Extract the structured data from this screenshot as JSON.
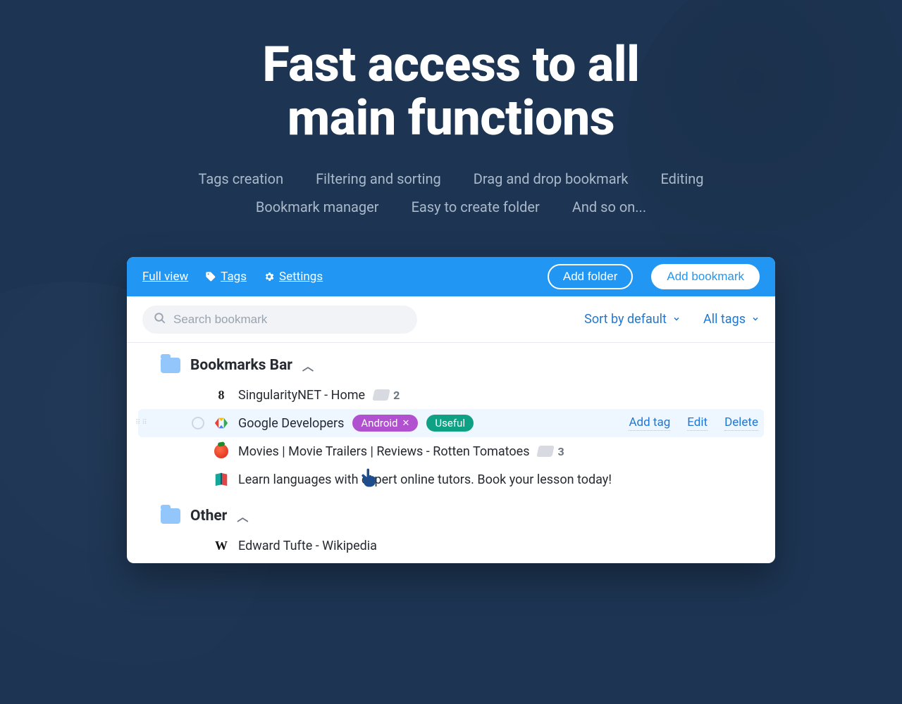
{
  "hero": {
    "title_line1": "Fast access to all",
    "title_line2": "main functions"
  },
  "features": [
    "Tags creation",
    "Filtering and sorting",
    "Drag and drop bookmark",
    "Editing",
    "Bookmark manager",
    "Easy to create folder",
    "And so on..."
  ],
  "toolbar": {
    "full_view": "Full view",
    "tags": "Tags",
    "settings": "Settings",
    "add_folder": "Add folder",
    "add_bookmark": "Add bookmark"
  },
  "controls": {
    "search_placeholder": "Search bookmark",
    "sort": "Sort by default",
    "all_tags": "All tags"
  },
  "folders": [
    {
      "name": "Bookmarks Bar",
      "items": [
        {
          "title": "SingularityNET - Home",
          "tag_count": "2",
          "favicon": "singularitynet"
        },
        {
          "title": "Google Developers",
          "favicon": "gdev",
          "tags": [
            {
              "label": "Android",
              "color": "purple",
              "removable": true
            },
            {
              "label": "Useful",
              "color": "green",
              "removable": false
            }
          ],
          "active": true,
          "actions": {
            "addtag": "Add tag",
            "edit": "Edit",
            "delete": "Delete"
          }
        },
        {
          "title": "Movies | Movie Trailers | Reviews - Rotten Tomatoes",
          "tag_count": "3",
          "favicon": "tomato"
        },
        {
          "title": "Learn languages with expert online tutors. Book your lesson today!",
          "favicon": "preply"
        }
      ]
    },
    {
      "name": "Other",
      "items": [
        {
          "title": "Edward Tufte - Wikipedia",
          "favicon": "wiki"
        }
      ]
    }
  ]
}
